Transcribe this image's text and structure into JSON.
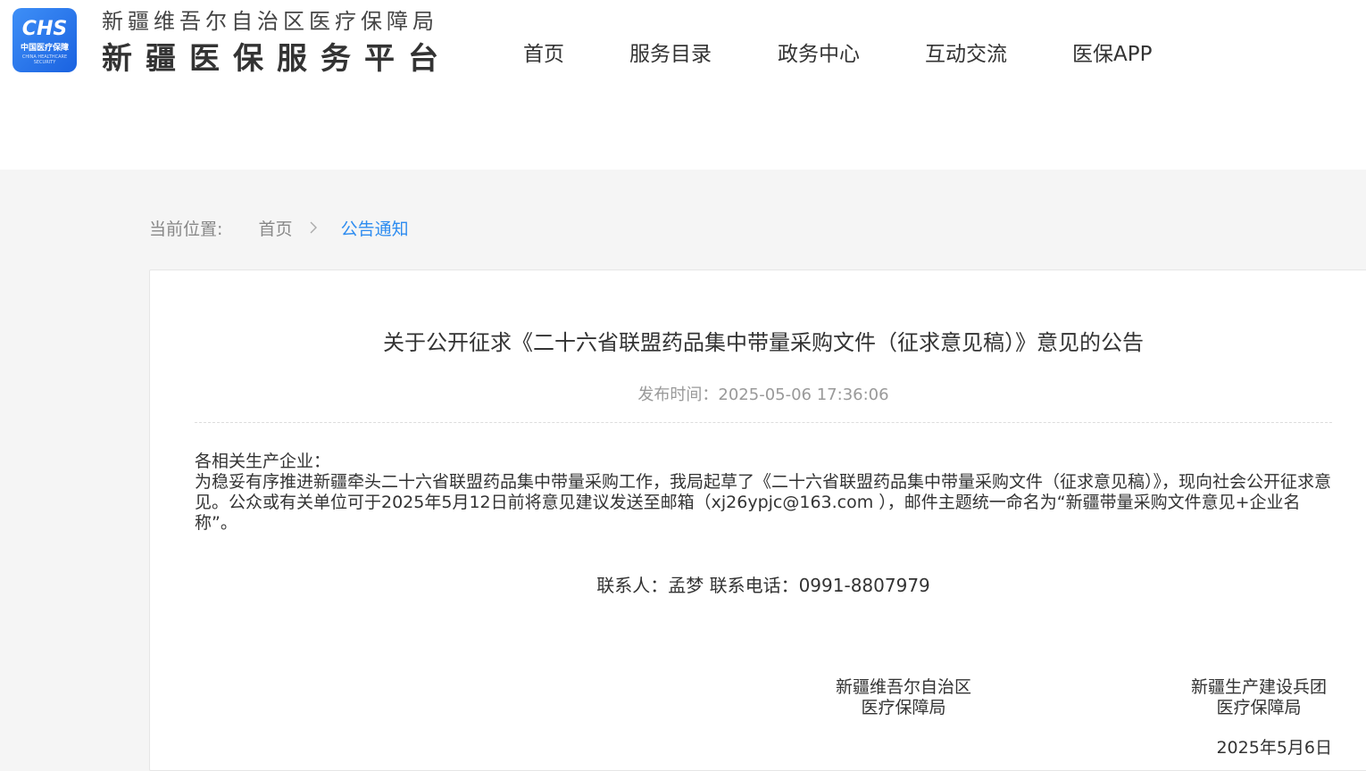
{
  "header": {
    "logo": {
      "mark": "CHS",
      "sub": "中国医疗保障",
      "tiny": "CHINA HEALTHCARE SECURITY"
    },
    "org_name": "新疆维吾尔自治区医疗保障局",
    "site_name": "新疆医保服务平台",
    "nav": [
      {
        "label": "首页"
      },
      {
        "label": "服务目录"
      },
      {
        "label": "政务中心"
      },
      {
        "label": "互动交流"
      },
      {
        "label": "医保APP"
      }
    ]
  },
  "breadcrumb": {
    "prefix": "当前位置:",
    "home": "首页",
    "separator": ">",
    "current": "公告通知"
  },
  "article": {
    "title": "关于公开征求《二十六省联盟药品集中带量采购文件（征求意见稿）》意见的公告",
    "publish_time": "发布时间：2025-05-06 17:36:06",
    "salutation": "各相关生产企业：",
    "paragraph": "为稳妥有序推进新疆牵头二十六省联盟药品集中带量采购工作，我局起草了《二十六省联盟药品集中带量采购文件（征求意见稿）》，现向社会公开征求意见。公众或有关单位可于2025年5月12日前将意见建议发送至邮箱（xj26ypjc@163.com ），邮件主题统一命名为“新疆带量采购文件意见+企业名称”。",
    "contact": "联系人：孟梦 联系电话：0991-8807979",
    "signatures": [
      {
        "line1": "新疆维吾尔自治区",
        "line2": "医疗保障局"
      },
      {
        "line1": "新疆生产建设兵团",
        "line2": "医疗保障局"
      }
    ],
    "date": "2025年5月6日"
  },
  "colors": {
    "accent": "#2d8cf0",
    "logo_blue": "#1a62e0",
    "page_bg": "#f5f5f5"
  }
}
